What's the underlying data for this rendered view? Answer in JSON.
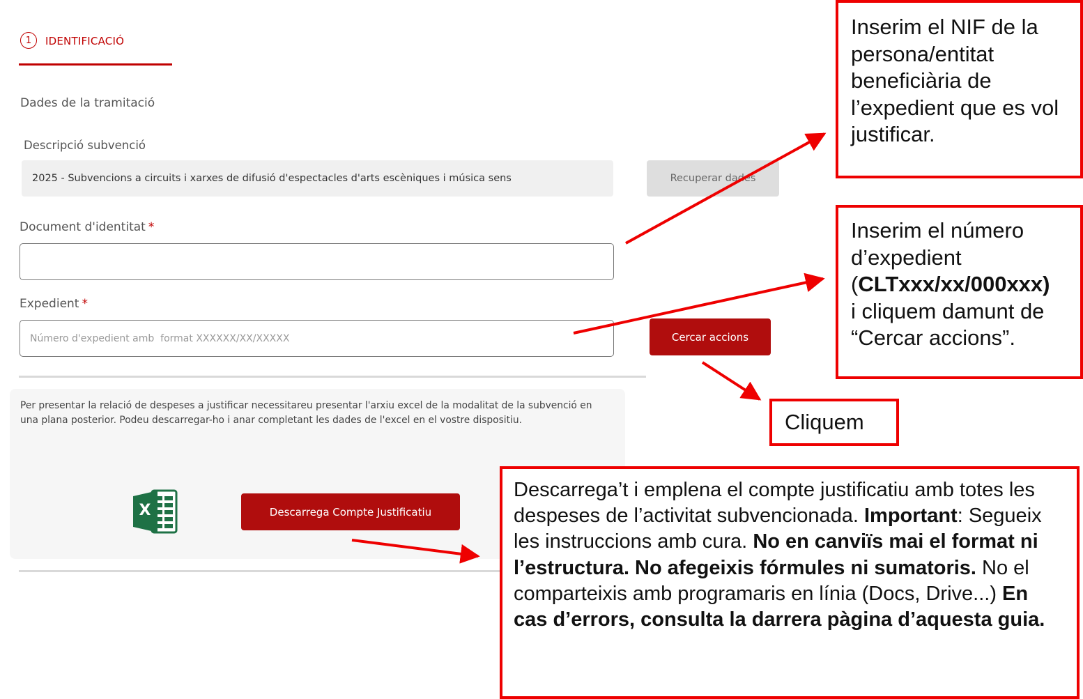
{
  "step": {
    "number": "1",
    "title": "IDENTIFICACIÓ"
  },
  "form": {
    "section_title": "Dades de la tramitació",
    "desc_label": "Descripció subvenció",
    "desc_value": "2025 - Subvencions a circuits i xarxes de difusió d'espectacles d'arts escèniques i música sens",
    "recover_button": "Recuperar dades",
    "id_label": "Document d'identitat",
    "required_mark": "*",
    "id_value": "",
    "exp_label": "Expedient",
    "exp_placeholder": "Número d'expedient amb  format XXXXXX/XX/XXXXX",
    "search_button": "Cercar accions"
  },
  "info": {
    "text": "Per presentar la relació de despeses a justificar necessitareu presentar l'arxiu excel de la modalitat de la subvenció en una plana posterior. Podeu descarregar-ho i anar completant les dades de l'excel en el vostre dispositiu.",
    "excel_icon_letter": "X",
    "download_button": "Descarrega Compte Justificatiu"
  },
  "callouts": {
    "nif": "Inserim el NIF de la persona/entitat beneficiària de l’expedient que es vol justificar.",
    "exp_line1": "Inserim el número d’expedient",
    "exp_open": "(",
    "exp_code": "CLTxxx/xx/000xxx)",
    "exp_line3": "i cliquem damunt de “Cercar accions”.",
    "click": "Cliquem",
    "dl_intro": "Descarrega’t i emplena el compte justificatiu amb totes les despeses de l’activitat subvencionada.",
    "dl_important": "Important",
    "dl_after_important": ": Segueix les instruccions amb cura. ",
    "dl_bold1": "No en canviïs mai el format ni l’estructura. No afegeixis fórmules ni sumatoris.",
    "dl_plain2": " No el comparteixis amb programaris en línia (Docs, Drive...) ",
    "dl_bold2": "En cas d’errors, consulta la darrera pàgina d’aquesta guia."
  },
  "colors": {
    "accent": "#c00000",
    "button_red": "#b00d0d",
    "callout_border": "#ee0000",
    "excel_green": "#1e7145"
  }
}
